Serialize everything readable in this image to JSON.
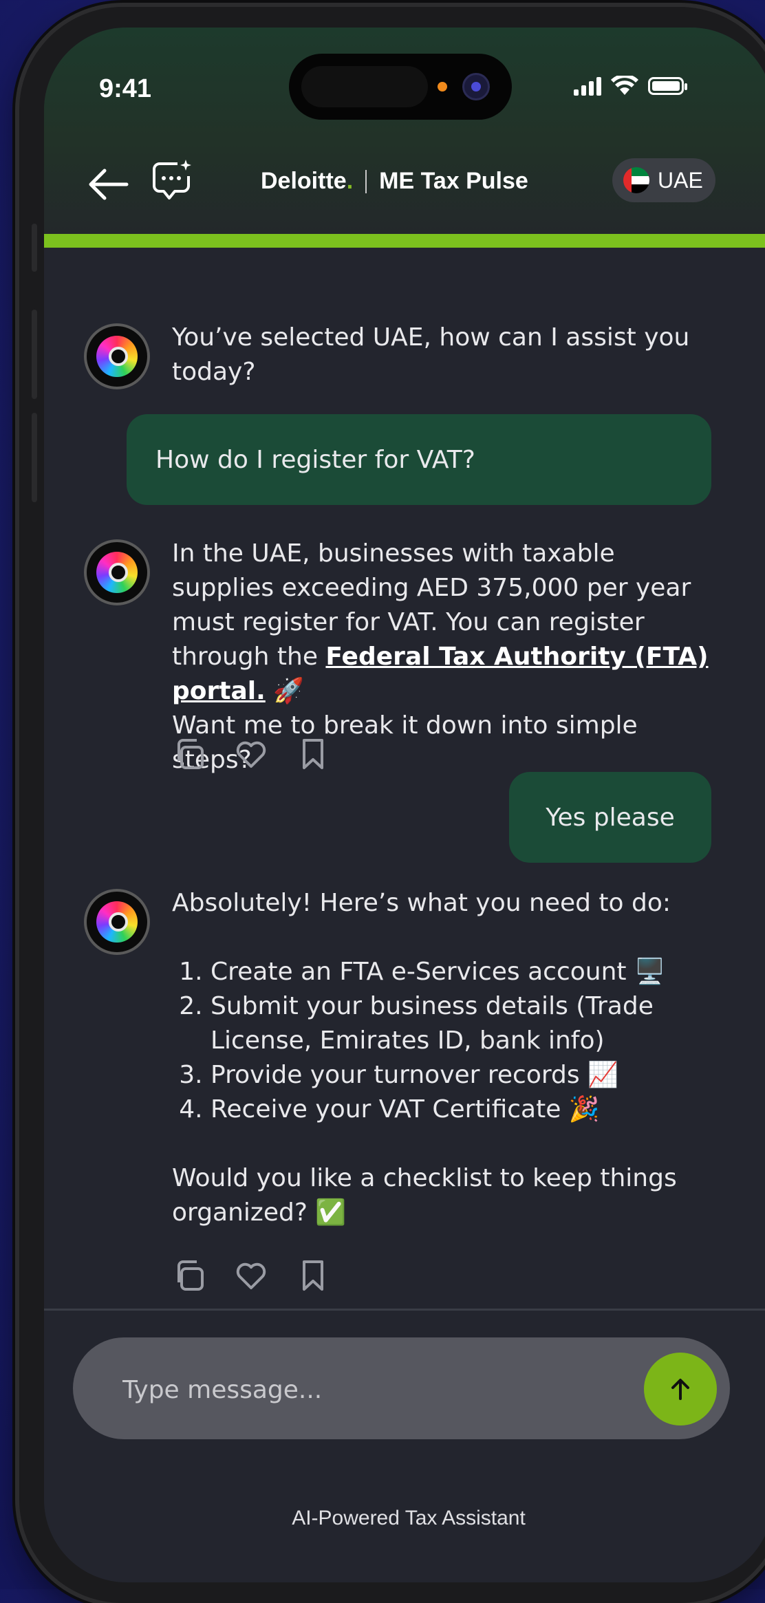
{
  "status_bar": {
    "time": "9:41"
  },
  "header": {
    "brand": "Deloitte",
    "brand_dot": ".",
    "app_title": "ME Tax Pulse",
    "country": "UAE",
    "accent_color": "#7cc11e"
  },
  "icons": {
    "back": "arrow-left-icon",
    "new_chat": "chat-sparkle-icon",
    "copy": "copy-icon",
    "like": "heart-icon",
    "save": "bookmark-icon",
    "send": "arrow-up-icon"
  },
  "messages": {
    "bot1": {
      "text": "You’ve selected UAE, how can I assist you today?"
    },
    "user1": {
      "text": "How do I register for VAT?"
    },
    "bot2": {
      "text_before": "In the UAE, businesses with taxable supplies exceeding AED 375,000 per year must register for VAT. You can register through the ",
      "link": "Federal Tax Authority (FTA) portal.",
      "emoji1": "🚀",
      "text_after": "Want me to break it down into simple steps?"
    },
    "user2": {
      "text": "Yes please"
    },
    "bot3": {
      "intro": "Absolutely! Here’s what you need to do:",
      "steps": [
        "Create an FTA e-Services account 🖥️",
        "Submit your business details (Trade License, Emirates ID, bank info)",
        "Provide your turnover records 📈",
        "Receive your VAT Certificate 🎉"
      ],
      "outro": "Would you like a checklist to keep things organized? ✅"
    }
  },
  "composer": {
    "placeholder": "Type message..."
  },
  "footer": {
    "note": "AI-Powered Tax Assistant"
  }
}
